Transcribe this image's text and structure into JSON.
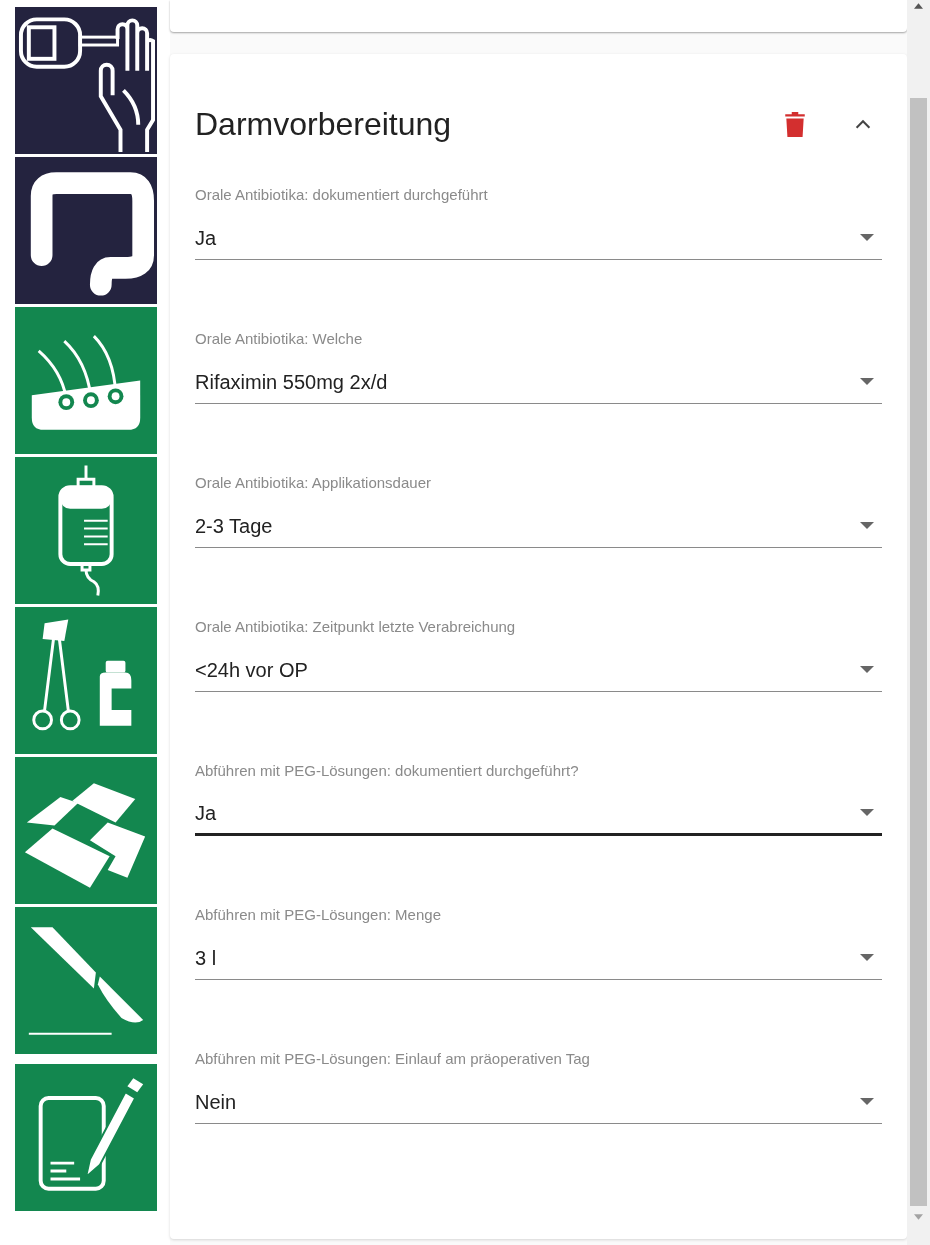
{
  "sidebar": {
    "tiles": [
      {
        "color": "#24233f"
      },
      {
        "color": "#24233f"
      },
      {
        "color": "#13874f"
      },
      {
        "color": "#13874f"
      },
      {
        "color": "#13874f"
      },
      {
        "color": "#13874f"
      },
      {
        "color": "#13874f"
      },
      {
        "color": "#13874f"
      }
    ]
  },
  "section": {
    "title": "Darmvorbereitung",
    "expanded": true,
    "fields": [
      {
        "label": "Orale Antibiotika: dokumentiert durchgeführt",
        "value": "Ja",
        "focused": false
      },
      {
        "label": "Orale Antibiotika: Welche",
        "value": "Rifaximin 550mg 2x/d",
        "focused": false
      },
      {
        "label": "Orale Antibiotika: Applikationsdauer",
        "value": "2-3 Tage",
        "focused": false
      },
      {
        "label": "Orale Antibiotika: Zeitpunkt letzte Verabreichung",
        "value": "<24h vor OP",
        "focused": false
      },
      {
        "label": "Abführen mit PEG-Lösungen: dokumentiert durchgeführt?",
        "value": "Ja",
        "focused": true
      },
      {
        "label": "Abführen mit PEG-Lösungen: Menge",
        "value": "3 l",
        "focused": false
      },
      {
        "label": "Abführen mit PEG-Lösungen: Einlauf am präoperativen Tag",
        "value": "Nein",
        "focused": false
      }
    ]
  }
}
